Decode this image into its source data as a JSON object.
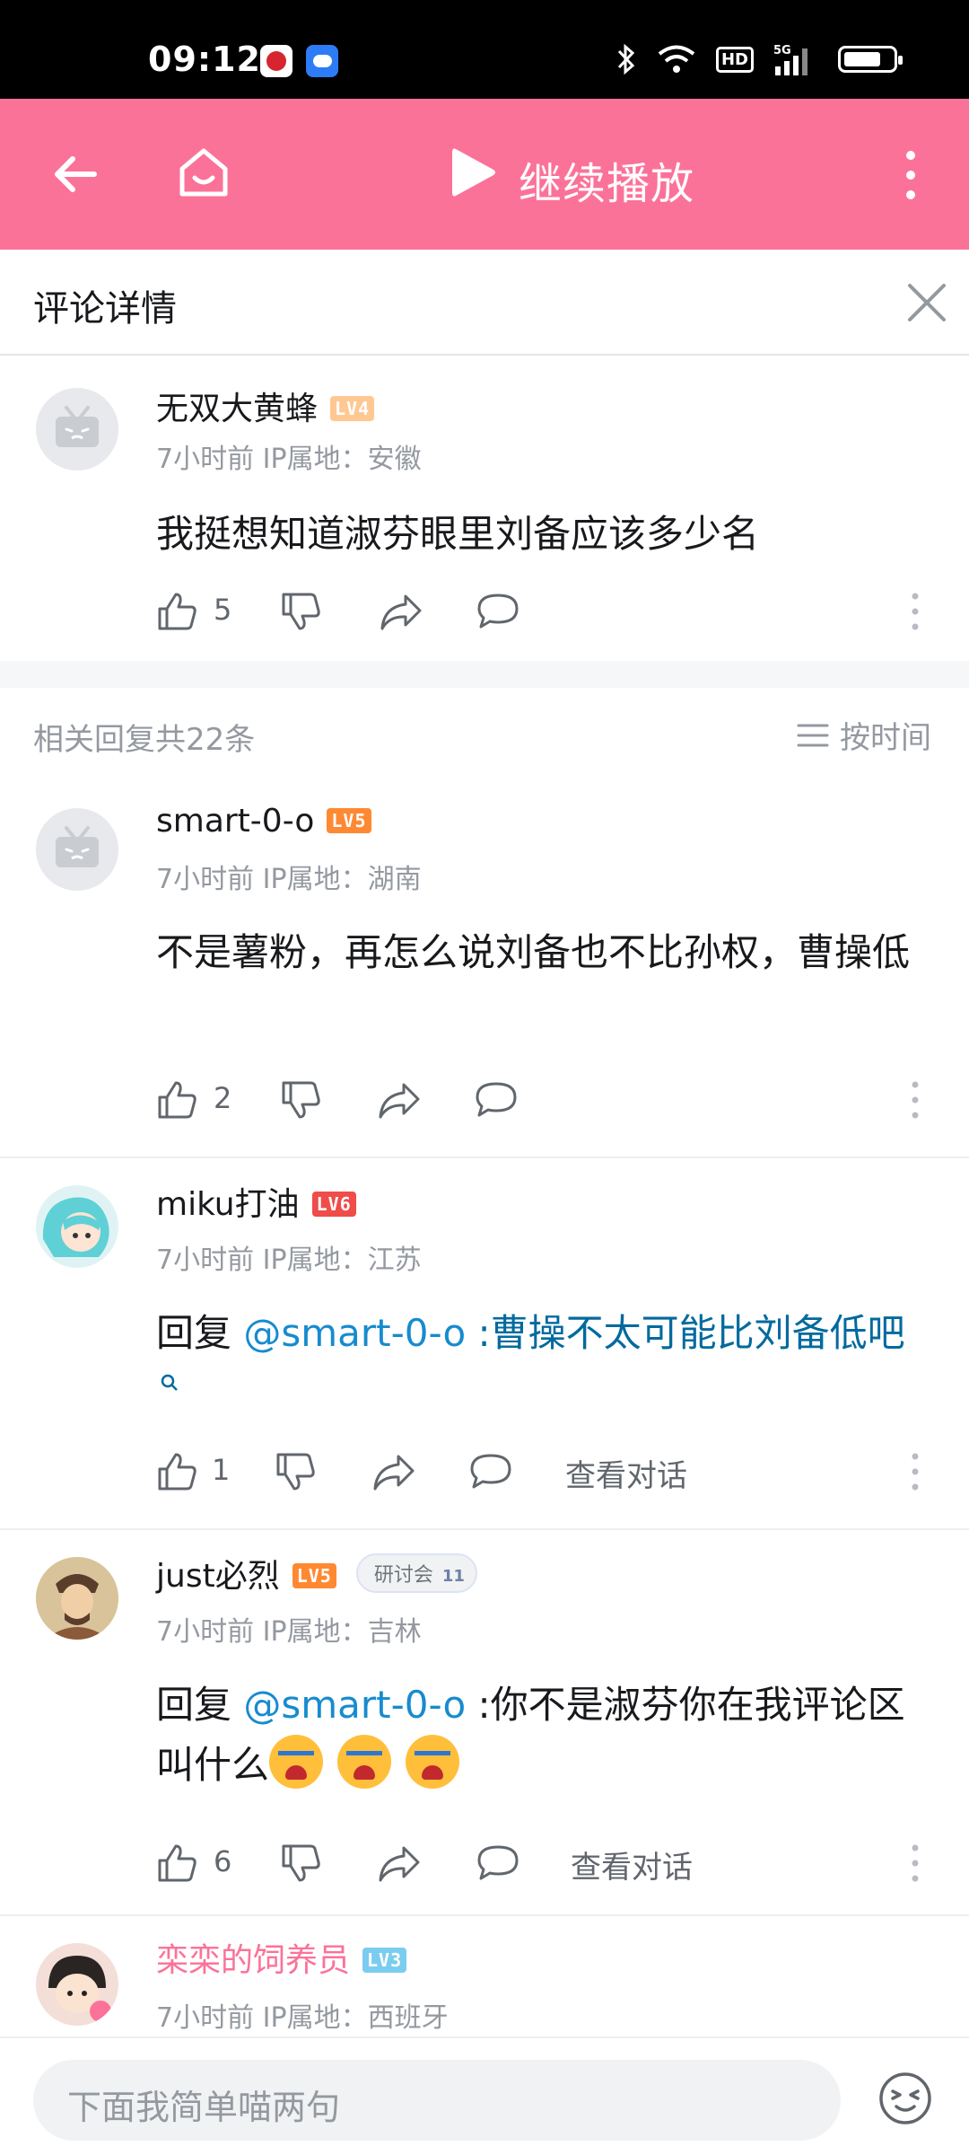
{
  "status_bar": {
    "time": "09:12",
    "hd_label": "HD",
    "network": "5G"
  },
  "app_bar": {
    "play_label": "继续播放"
  },
  "detail": {
    "title": "评论详情"
  },
  "root_comment": {
    "username": "无双大黄蜂",
    "level": "LV4",
    "time": "7小时前",
    "ip": "IP属地：安徽",
    "content": "我挺想知道淑芬眼里刘备应该多少名",
    "likes": "5"
  },
  "replies_header": {
    "count_text": "相关回复共22条",
    "sort_label": "按时间"
  },
  "replies": [
    {
      "username": "smart-0-o",
      "level": "LV5",
      "time": "7小时前",
      "ip": "IP属地：湖南",
      "content": "不是薯粉，再怎么说刘备也不比孙权，曹操低",
      "likes": "2"
    },
    {
      "username": "miku打油",
      "level": "LV6",
      "time": "7小时前",
      "ip": "IP属地：江苏",
      "reply_prefix": "回复",
      "mention": "@smart-0-o",
      "content": ":曹操不太可能比刘备低吧",
      "likes": "1",
      "view_conversation": "查看对话"
    },
    {
      "username": "just必烈",
      "level": "LV5",
      "fan_badge": "研讨会",
      "fan_level": "11",
      "time": "7小时前",
      "ip": "IP属地：吉林",
      "reply_prefix": "回复",
      "mention": "@smart-0-o",
      "content": ":你不是淑芬你在我评论区叫什么",
      "likes": "6",
      "view_conversation": "查看对话"
    },
    {
      "username": "栾栾的饲养员",
      "level": "LV3",
      "time": "7小时前",
      "ip": "IP属地：西班牙"
    }
  ],
  "bottom_bar": {
    "input_placeholder": "下面我简单喵两句"
  },
  "colors": {
    "accent_pink": "#fb7299",
    "mention_blue": "#178bcf",
    "meta_grey": "#9499a0"
  }
}
